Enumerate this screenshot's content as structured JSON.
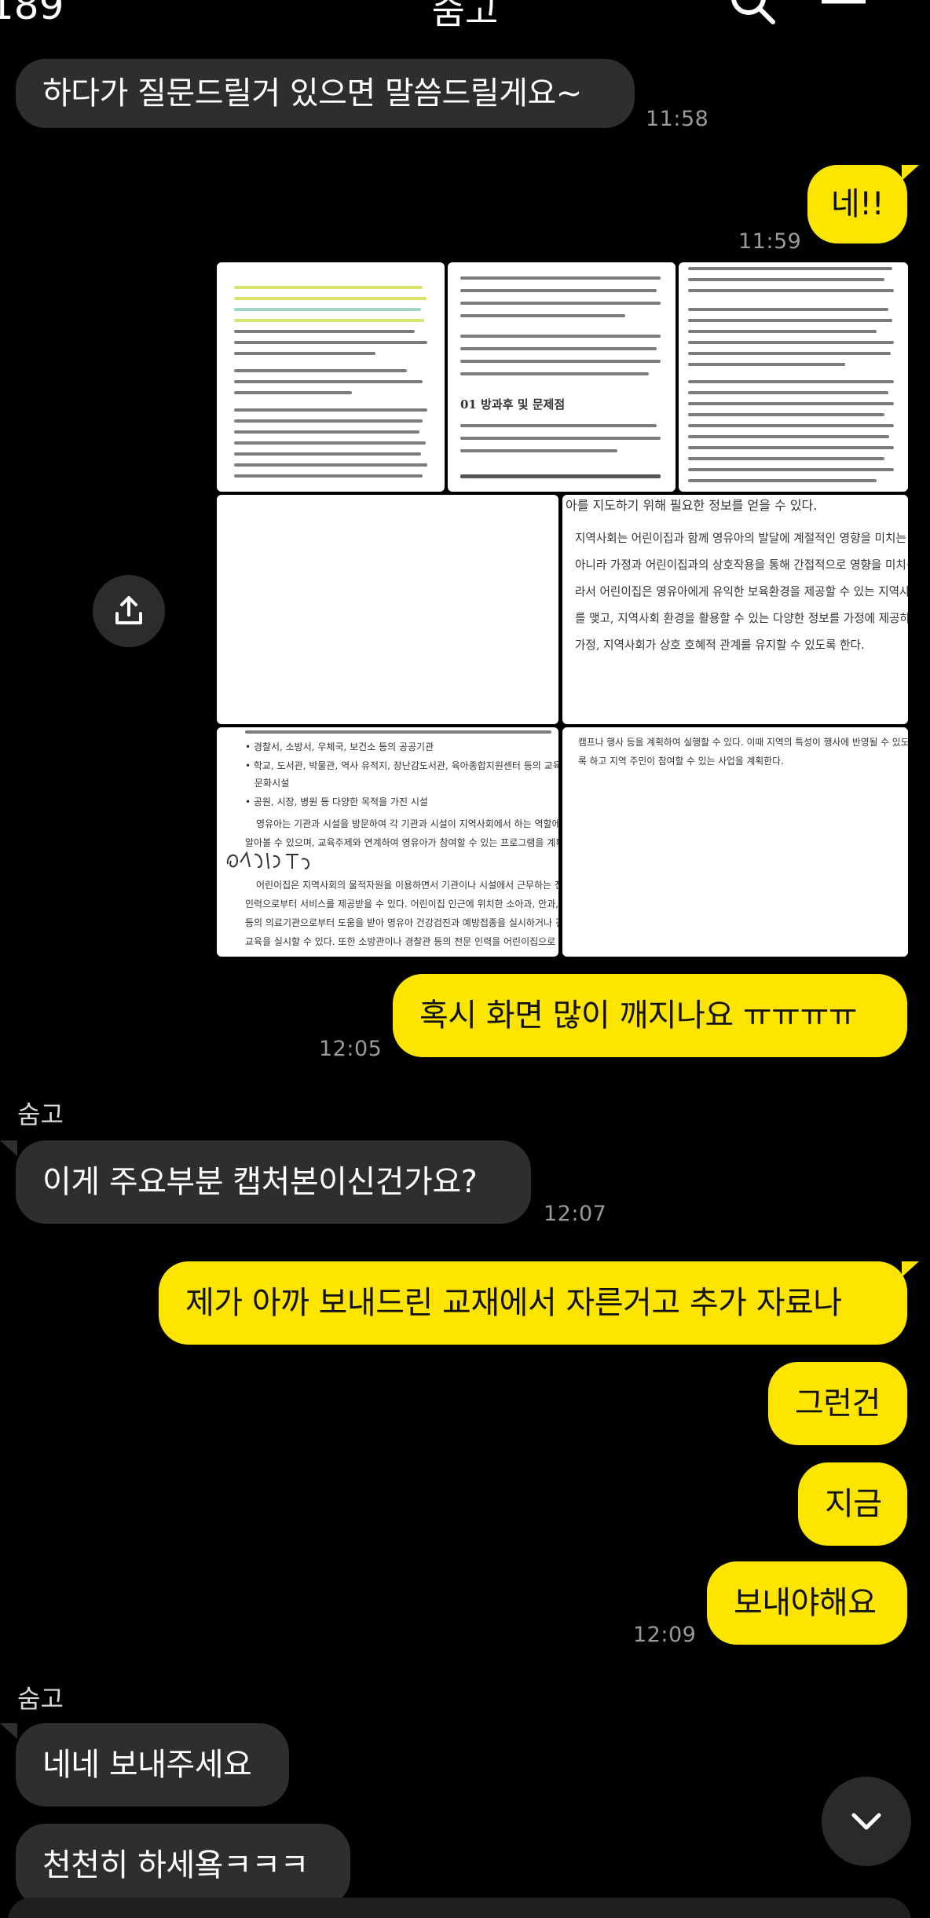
{
  "status": {
    "time": "189"
  },
  "header": {
    "title": "숨고",
    "search_icon": "search-icon",
    "menu_icon": "hamburger-menu-icon"
  },
  "messages": [
    {
      "id": "m1",
      "from": "them",
      "text": "하다가 질문드릴거 있으면 말씀드릴게요~",
      "time": "11:58"
    },
    {
      "id": "m2",
      "from": "me",
      "text": "네!!",
      "time": "11:59"
    },
    {
      "id": "m3",
      "from": "me",
      "type": "photos",
      "photo_count": 7
    },
    {
      "id": "m4",
      "from": "me",
      "text": "혹시 화면 많이 깨지나요 ㅠㅠㅠㅠ",
      "time": "12:05"
    },
    {
      "id": "m5",
      "from": "them",
      "sender": "숨고",
      "text": "이게 주요부분 캡처본이신건가요?",
      "time": "12:07"
    },
    {
      "id": "m6",
      "from": "me",
      "text": "제가 아까 보내드린 교재에서 자른거고 추가 자료나"
    },
    {
      "id": "m7",
      "from": "me",
      "text": "그런건"
    },
    {
      "id": "m8",
      "from": "me",
      "text": "지금"
    },
    {
      "id": "m9",
      "from": "me",
      "text": "보내야해요",
      "time": "12:09"
    },
    {
      "id": "m10",
      "from": "them",
      "sender": "숨고",
      "text": "네네 보내주세요"
    },
    {
      "id": "m11",
      "from": "them",
      "text": "천천히 하세욬ㅋㅋㅋ"
    }
  ],
  "photo_text": {
    "p2_heading": "01 방과후 및 문제점",
    "p5_line1": "아를 지도하기 위해 필요한 정보를 얻을 수 있다.",
    "p5_line2": "지역사회는 어린이집과 함께 영유아의 발달에 계절적인 영향을 미치는 환경일 뿐만",
    "p5_line3": "아니라 가정과 어린이집과의 상호작용을 통해 간접적으로 영향을 미치는 환경이다. 따",
    "p5_line4": "라서 어린이집은 영유아에게 유익한 보육환경을 제공할 수 있는 지역사회와 협력관계",
    "p5_line5": "를 맺고, 지역사회 환경을 활용할 수 있는 다양한 정보를 가정에 제공하여 어린이집과",
    "p5_line6": "가정, 지역사회가 상호 호혜적 관계를 유지할 수 있도록 한다.",
    "p6_line1": "• 경찰서, 소방서, 우체국, 보건소 등의 공공기관",
    "p6_line2": "• 학교, 도서관, 박물관, 역사 유적지, 장난감도서관, 육아종합지원센터 등의 교육 ·",
    "p6_line3": "문화시설",
    "p6_line4": "• 공원, 시장, 병원 등 다양한 목적을 가진 시설",
    "p6_line5": "영유아는 기관과 시설을 방문하여 각 기관과 시설이 지역사회에서 하는 역할에 대해",
    "p6_line6": "알아볼 수 있으며, 교육주제와 연계하여 영유아가 참여할 수 있는 프로그램을 계획해",
    "p6_line7": "어린이집은 지역사회의 물적자원을 이용하면서 기관이나 시설에서 근무하는 전문",
    "p6_line8": "인력으로부터 서비스를 제공받을 수 있다. 어린이집 인근에 위치한 소아과, 안과, 치과",
    "p6_line9": "등의 의료기관으로부터 도움을 받아 영유아 건강검진과 예방접종을 실시하거나 건강",
    "p6_line10": "교육을 실시할 수 있다. 또한 소방관이나 경찰관 등의 전문 인력을 어린이집으로 초청",
    "p7_line1": "캠프나 행사 등을 계획하여 실행할 수 있다. 이때 지역의 특성이 행사에 반영될 수 있도",
    "p7_line2": "록 하고 지역 주민이 참여할 수 있는 사업을 계획한다."
  },
  "controls": {
    "share_icon": "share-icon",
    "scroll_down_icon": "chevron-down-icon"
  },
  "colors": {
    "background": "#000000",
    "incoming_bubble": "#2e2e30",
    "outgoing_bubble": "#fee500",
    "timestamp": "#9a9a9a"
  }
}
